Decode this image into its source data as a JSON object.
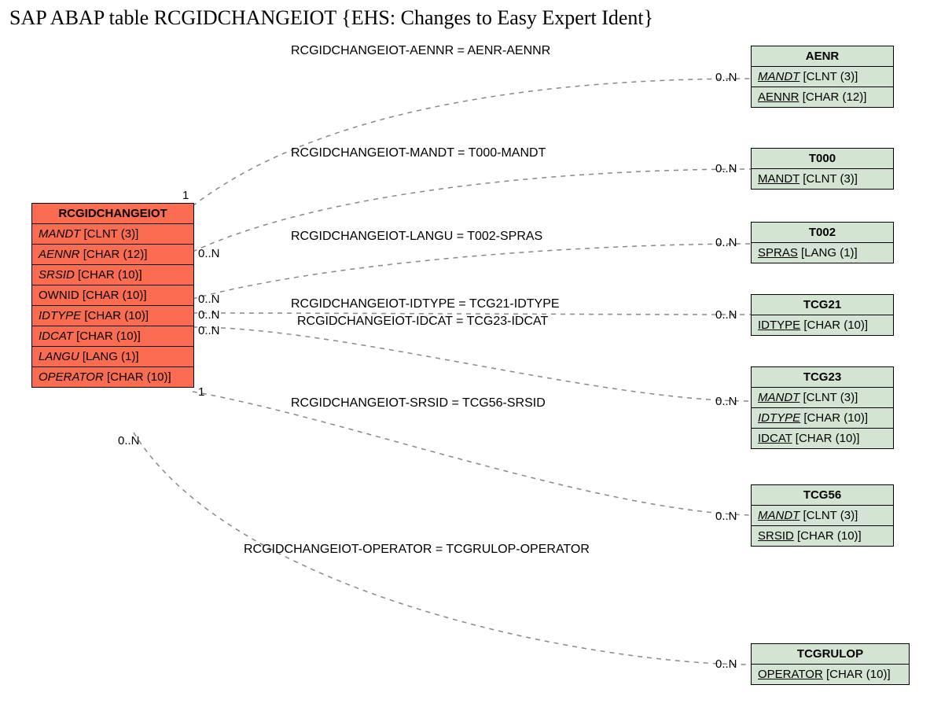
{
  "title": "SAP ABAP table RCGIDCHANGEIOT {EHS: Changes to Easy Expert Ident}",
  "main": {
    "name": "RCGIDCHANGEIOT",
    "fields": [
      {
        "name": "MANDT",
        "type": "[CLNT (3)]",
        "fk": true
      },
      {
        "name": "AENNR",
        "type": "[CHAR (12)]",
        "fk": true
      },
      {
        "name": "SRSID",
        "type": "[CHAR (10)]",
        "fk": true
      },
      {
        "name": "OWNID",
        "type": "[CHAR (10)]",
        "fk": false
      },
      {
        "name": "IDTYPE",
        "type": "[CHAR (10)]",
        "fk": true
      },
      {
        "name": "IDCAT",
        "type": "[CHAR (10)]",
        "fk": true
      },
      {
        "name": "LANGU",
        "type": "[LANG (1)]",
        "fk": true
      },
      {
        "name": "OPERATOR",
        "type": "[CHAR (10)]",
        "fk": true
      }
    ]
  },
  "refs": {
    "aenr": {
      "name": "AENR",
      "fields": [
        {
          "name": "MANDT",
          "type": "[CLNT (3)]",
          "pk": true,
          "fk": true
        },
        {
          "name": "AENNR",
          "type": "[CHAR (12)]",
          "pk": true
        }
      ]
    },
    "t000": {
      "name": "T000",
      "fields": [
        {
          "name": "MANDT",
          "type": "[CLNT (3)]",
          "pk": true
        }
      ]
    },
    "t002": {
      "name": "T002",
      "fields": [
        {
          "name": "SPRAS",
          "type": "[LANG (1)]",
          "pk": true
        }
      ]
    },
    "tcg21": {
      "name": "TCG21",
      "fields": [
        {
          "name": "IDTYPE",
          "type": "[CHAR (10)]",
          "pk": true
        }
      ]
    },
    "tcg23": {
      "name": "TCG23",
      "fields": [
        {
          "name": "MANDT",
          "type": "[CLNT (3)]",
          "pk": true,
          "fk": true
        },
        {
          "name": "IDTYPE",
          "type": "[CHAR (10)]",
          "pk": true,
          "fk": true
        },
        {
          "name": "IDCAT",
          "type": "[CHAR (10)]",
          "pk": true
        }
      ]
    },
    "tcg56": {
      "name": "TCG56",
      "fields": [
        {
          "name": "MANDT",
          "type": "[CLNT (3)]",
          "pk": true,
          "fk": true
        },
        {
          "name": "SRSID",
          "type": "[CHAR (10)]",
          "pk": true
        }
      ]
    },
    "tcgrulop": {
      "name": "TCGRULOP",
      "fields": [
        {
          "name": "OPERATOR",
          "type": "[CHAR (10)]",
          "pk": true
        }
      ]
    }
  },
  "rels": {
    "r1": "RCGIDCHANGEIOT-AENNR = AENR-AENNR",
    "r2": "RCGIDCHANGEIOT-MANDT = T000-MANDT",
    "r3": "RCGIDCHANGEIOT-LANGU = T002-SPRAS",
    "r4": "RCGIDCHANGEIOT-IDTYPE = TCG21-IDTYPE",
    "r5": "RCGIDCHANGEIOT-IDCAT = TCG23-IDCAT",
    "r6": "RCGIDCHANGEIOT-SRSID = TCG56-SRSID",
    "r7": "RCGIDCHANGEIOT-OPERATOR = TCGRULOP-OPERATOR"
  },
  "cards": {
    "one": "1",
    "zn": "0..N"
  }
}
